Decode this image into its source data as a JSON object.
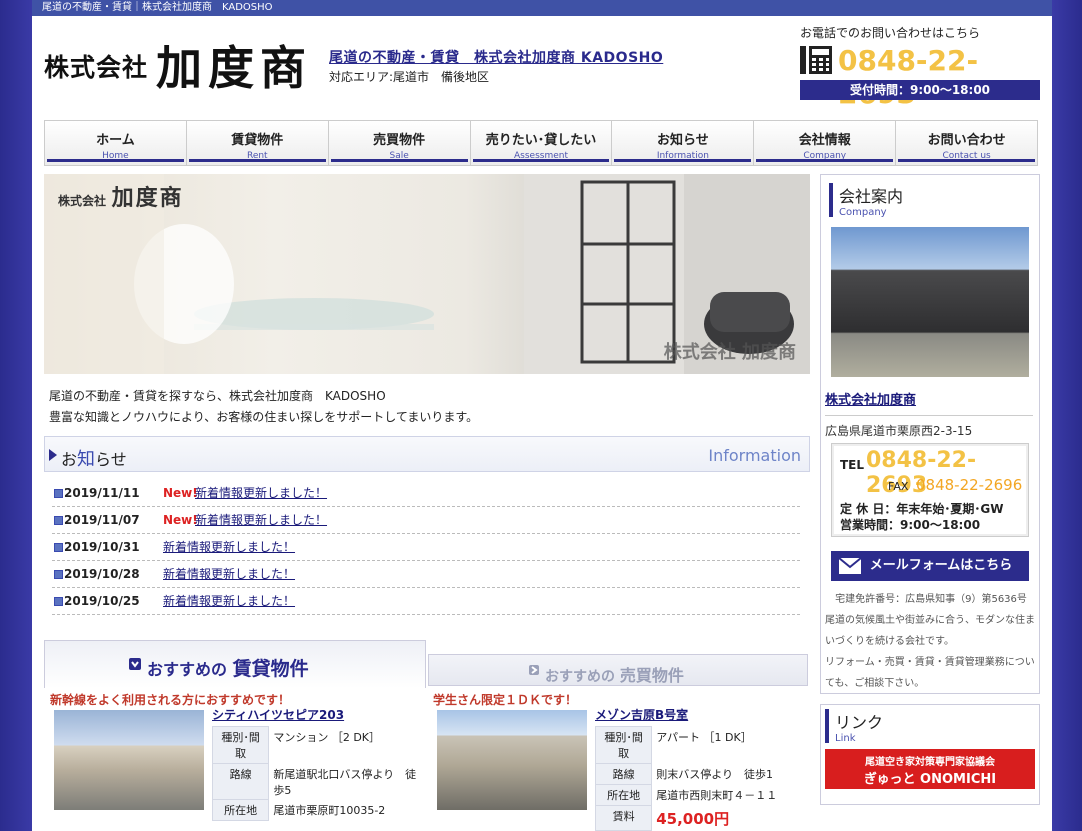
{
  "topbar": {
    "text": "尾道の不動産・賃貸｜株式会社加度商　KADOSHO"
  },
  "header": {
    "logo_small": "株式会社",
    "logo_big": "加度商",
    "tagline": "尾道の不動産・賃貸　株式会社加度商 KADOSHO",
    "area": "対応エリア:尾道市　備後地区",
    "phone_label": "お電話でのお問い合わせはこちら",
    "phone_number": "0848-22-2693",
    "hours": "受付時間：9:00〜18:00"
  },
  "nav": [
    {
      "jp": "ホーム",
      "en": "Home"
    },
    {
      "jp": "賃貸物件",
      "en": "Rent"
    },
    {
      "jp": "売買物件",
      "en": "Sale"
    },
    {
      "jp": "売りたい･貸したい",
      "en": "Assessment"
    },
    {
      "jp": "お知らせ",
      "en": "Information"
    },
    {
      "jp": "会社情報",
      "en": "Company"
    },
    {
      "jp": "お問い合わせ",
      "en": "Contact us"
    }
  ],
  "hero": {
    "logo_small": "株式会社",
    "logo_big": "加度商",
    "watermark": "株式会社 加度商"
  },
  "intro": {
    "line1": "尾道の不動産・賃貸を探すなら、株式会社加度商　KADOSHO",
    "line2": "豊富な知識とノウハウにより、お客様の住まい探しをサポートしてまいります。"
  },
  "info": {
    "title_pre": "お",
    "title_mid": "知",
    "title_post": "らせ",
    "en": "Information",
    "items": [
      {
        "date": "2019/11/11",
        "new": "New!",
        "text": "新着情報更新しました！"
      },
      {
        "date": "2019/11/07",
        "new": "New!",
        "text": "新着情報更新しました！"
      },
      {
        "date": "2019/10/31",
        "new": "",
        "text": "新着情報更新しました！"
      },
      {
        "date": "2019/10/28",
        "new": "",
        "text": "新着情報更新しました！"
      },
      {
        "date": "2019/10/25",
        "new": "",
        "text": "新着情報更新しました！"
      }
    ]
  },
  "rent": {
    "tab_pre": "おすすめの",
    "tab_main": "賃貸物件",
    "catch": "新幹線をよく利用される方におすすめです！",
    "title": "シティハイツセピア203",
    "rows": [
      {
        "h": "種別･間取",
        "v": "マンション ［2 DK］"
      },
      {
        "h": "路線",
        "v": "新尾道駅北口バス停より　徒歩5"
      },
      {
        "h": "所在地",
        "v": "尾道市栗原町10035-2"
      }
    ]
  },
  "sale": {
    "tab_pre": "おすすめの",
    "tab_main": "売買物件",
    "catch": "学生さん限定１ＤＫです！",
    "title": "メゾン吉原B号室",
    "rows": [
      {
        "h": "種別･間取",
        "v": "アパート ［1 DK］"
      },
      {
        "h": "路線",
        "v": "則末バス停より　徒歩1"
      },
      {
        "h": "所在地",
        "v": "尾道市西則末町４－１１"
      },
      {
        "h": "賃料",
        "v": "45,000円"
      }
    ]
  },
  "sidebar": {
    "title": "会社案内",
    "title_en": "Company",
    "company_name": "株式会社加度商",
    "address": "広島県尾道市栗原西2-3-15",
    "tel_label": "TEL",
    "tel": "0848-22-2693",
    "fax_label": "FAX",
    "fax": "0848-22-2696",
    "holiday": "定 休 日：年末年始･夏期･GW",
    "hours": "営業時間：9:00〜18:00",
    "mail_button": "メールフォームはこちら",
    "license": "宅建免許番号：広島県知事（9）第5636号",
    "desc": "尾道の気候風土や街並みに合う、モダンな住まいづくりを続ける会社です。",
    "desc2": "リフォーム・売買・賃貸・賃貸管理業務についても、ご相談下さい。"
  },
  "links": {
    "title": "リンク",
    "title_en": "Link",
    "banner_line1": "尾道空き家対策専門家協議会",
    "banner_line2": "ぎゅっと ONOMICHI"
  },
  "colors": {
    "brand_navy": "#2c2c8c",
    "accent_gold": "#f3c245",
    "new_red": "#d22222"
  }
}
